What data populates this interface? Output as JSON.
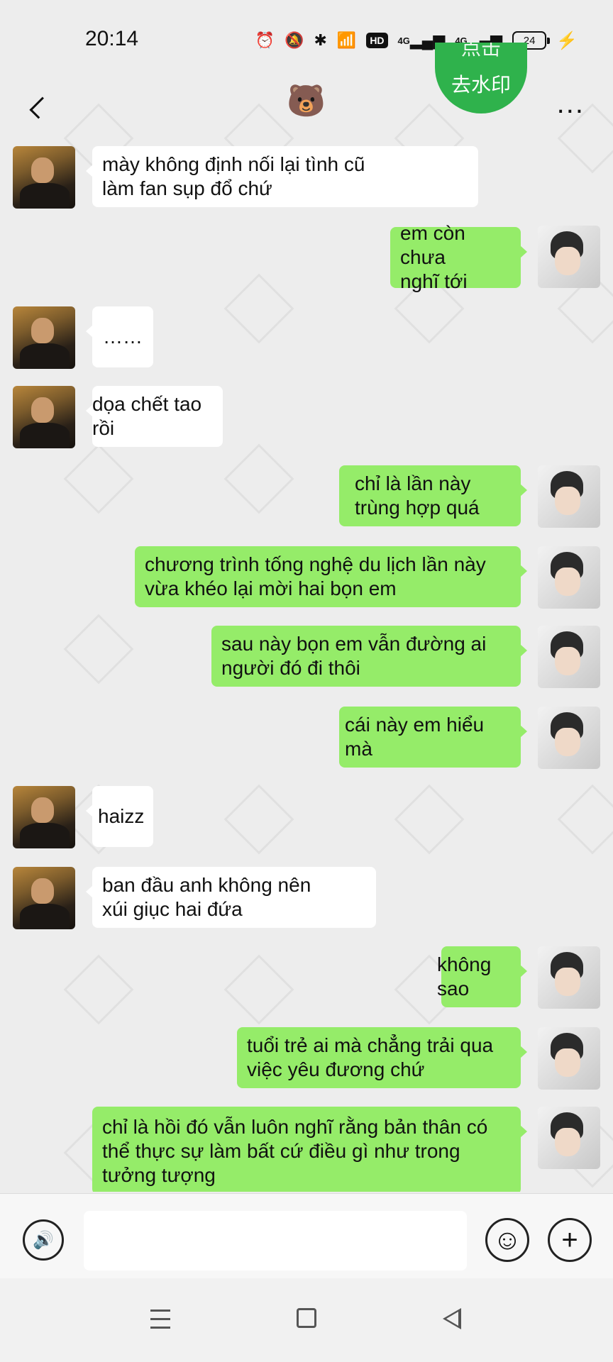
{
  "status_bar": {
    "time": "20:14",
    "icons": [
      "alarm-icon",
      "mute-icon",
      "bluetooth-icon",
      "wifi-icon",
      "hd-icon",
      "signal-4g-icon",
      "signal-4g-icon",
      "battery-icon",
      "charging-icon"
    ],
    "hd_label": "HD",
    "network_1": "4G",
    "network_2": "4G",
    "battery_level": "24"
  },
  "header": {
    "title": "🐻",
    "watermark_button_top": "点击",
    "watermark_button_label": "去水印",
    "more_label": "..."
  },
  "messages": [
    {
      "side": "in",
      "text": "mày không định nối lại tình cũ\nlàm fan sụp đổ chứ"
    },
    {
      "side": "out",
      "text": "em còn chưa\nnghĩ tới"
    },
    {
      "side": "in",
      "text": "……"
    },
    {
      "side": "in",
      "text": "dọa chết tao rồi"
    },
    {
      "side": "out",
      "text": "chỉ là lần này\ntrùng hợp quá"
    },
    {
      "side": "out",
      "text": "chương trình tống nghệ du lịch lần này\nvừa khéo lại mời hai bọn em"
    },
    {
      "side": "out",
      "text": "sau này bọn em vẫn đường ai\nngười đó đi thôi"
    },
    {
      "side": "out",
      "text": "cái này em hiểu mà"
    },
    {
      "side": "in",
      "text": "haizz"
    },
    {
      "side": "in",
      "text": "ban đầu anh không nên\nxúi giục hai đứa"
    },
    {
      "side": "out",
      "text": "không sao"
    },
    {
      "side": "out",
      "text": "tuổi trẻ ai mà chẳng trải qua\nviệc yêu đương chứ"
    },
    {
      "side": "out",
      "text": "chỉ là hồi đó vẫn luôn nghĩ rằng bản thân có\nthể thực sự làm bất cứ điều gì như trong\ntưởng tượng"
    }
  ],
  "input_bar": {
    "voice_icon": "voice-icon",
    "emoji_icon": "emoji-icon",
    "plus_icon": "plus-icon",
    "input_value": ""
  },
  "colors": {
    "background": "#ededed",
    "outgoing_bubble": "#95ec69",
    "incoming_bubble": "#ffffff",
    "watermark_button": "#2fb24c"
  }
}
